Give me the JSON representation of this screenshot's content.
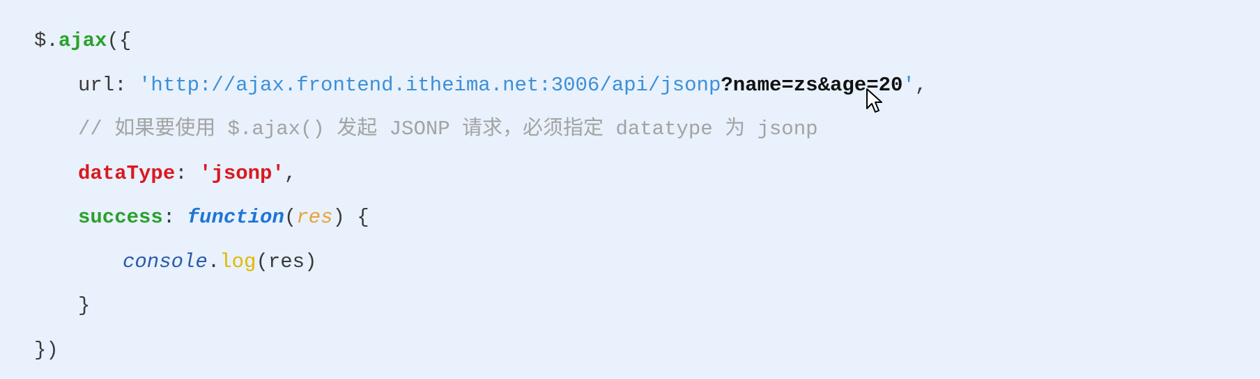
{
  "code": {
    "line1": {
      "prefix": "$.",
      "fn": "ajax",
      "suffix": "({"
    },
    "line2": {
      "key": "url: ",
      "string": "'http://ajax.frontend.itheima.net:3006/api/jsonp",
      "query": "?name=zs&age=20",
      "string_end": "'",
      "tail": ","
    },
    "line3": {
      "comment": "// 如果要使用 $.ajax() 发起 JSONP 请求，必须指定 datatype 为 jsonp"
    },
    "line4": {
      "key": "dataType",
      "colon": ": ",
      "value": "'jsonp'",
      "tail": ","
    },
    "line5": {
      "key": "success",
      "colon": ": ",
      "keyword": "function",
      "open": "(",
      "param": "res",
      "close": ") {"
    },
    "line6": {
      "object": "console",
      "dot": ".",
      "method": "log",
      "args": "(res)"
    },
    "line7": {
      "text": "}"
    },
    "line8": {
      "text": "})"
    }
  },
  "icons": {
    "cursor": "mouse-pointer-icon"
  },
  "colors": {
    "background": "#e8f1fc",
    "string": "#3d8fd6",
    "function_name": "#2aa02a",
    "key_red": "#d9191f",
    "keyword": "#1f74d6",
    "param": "#e8a33a",
    "comment": "#a3a3a3"
  }
}
